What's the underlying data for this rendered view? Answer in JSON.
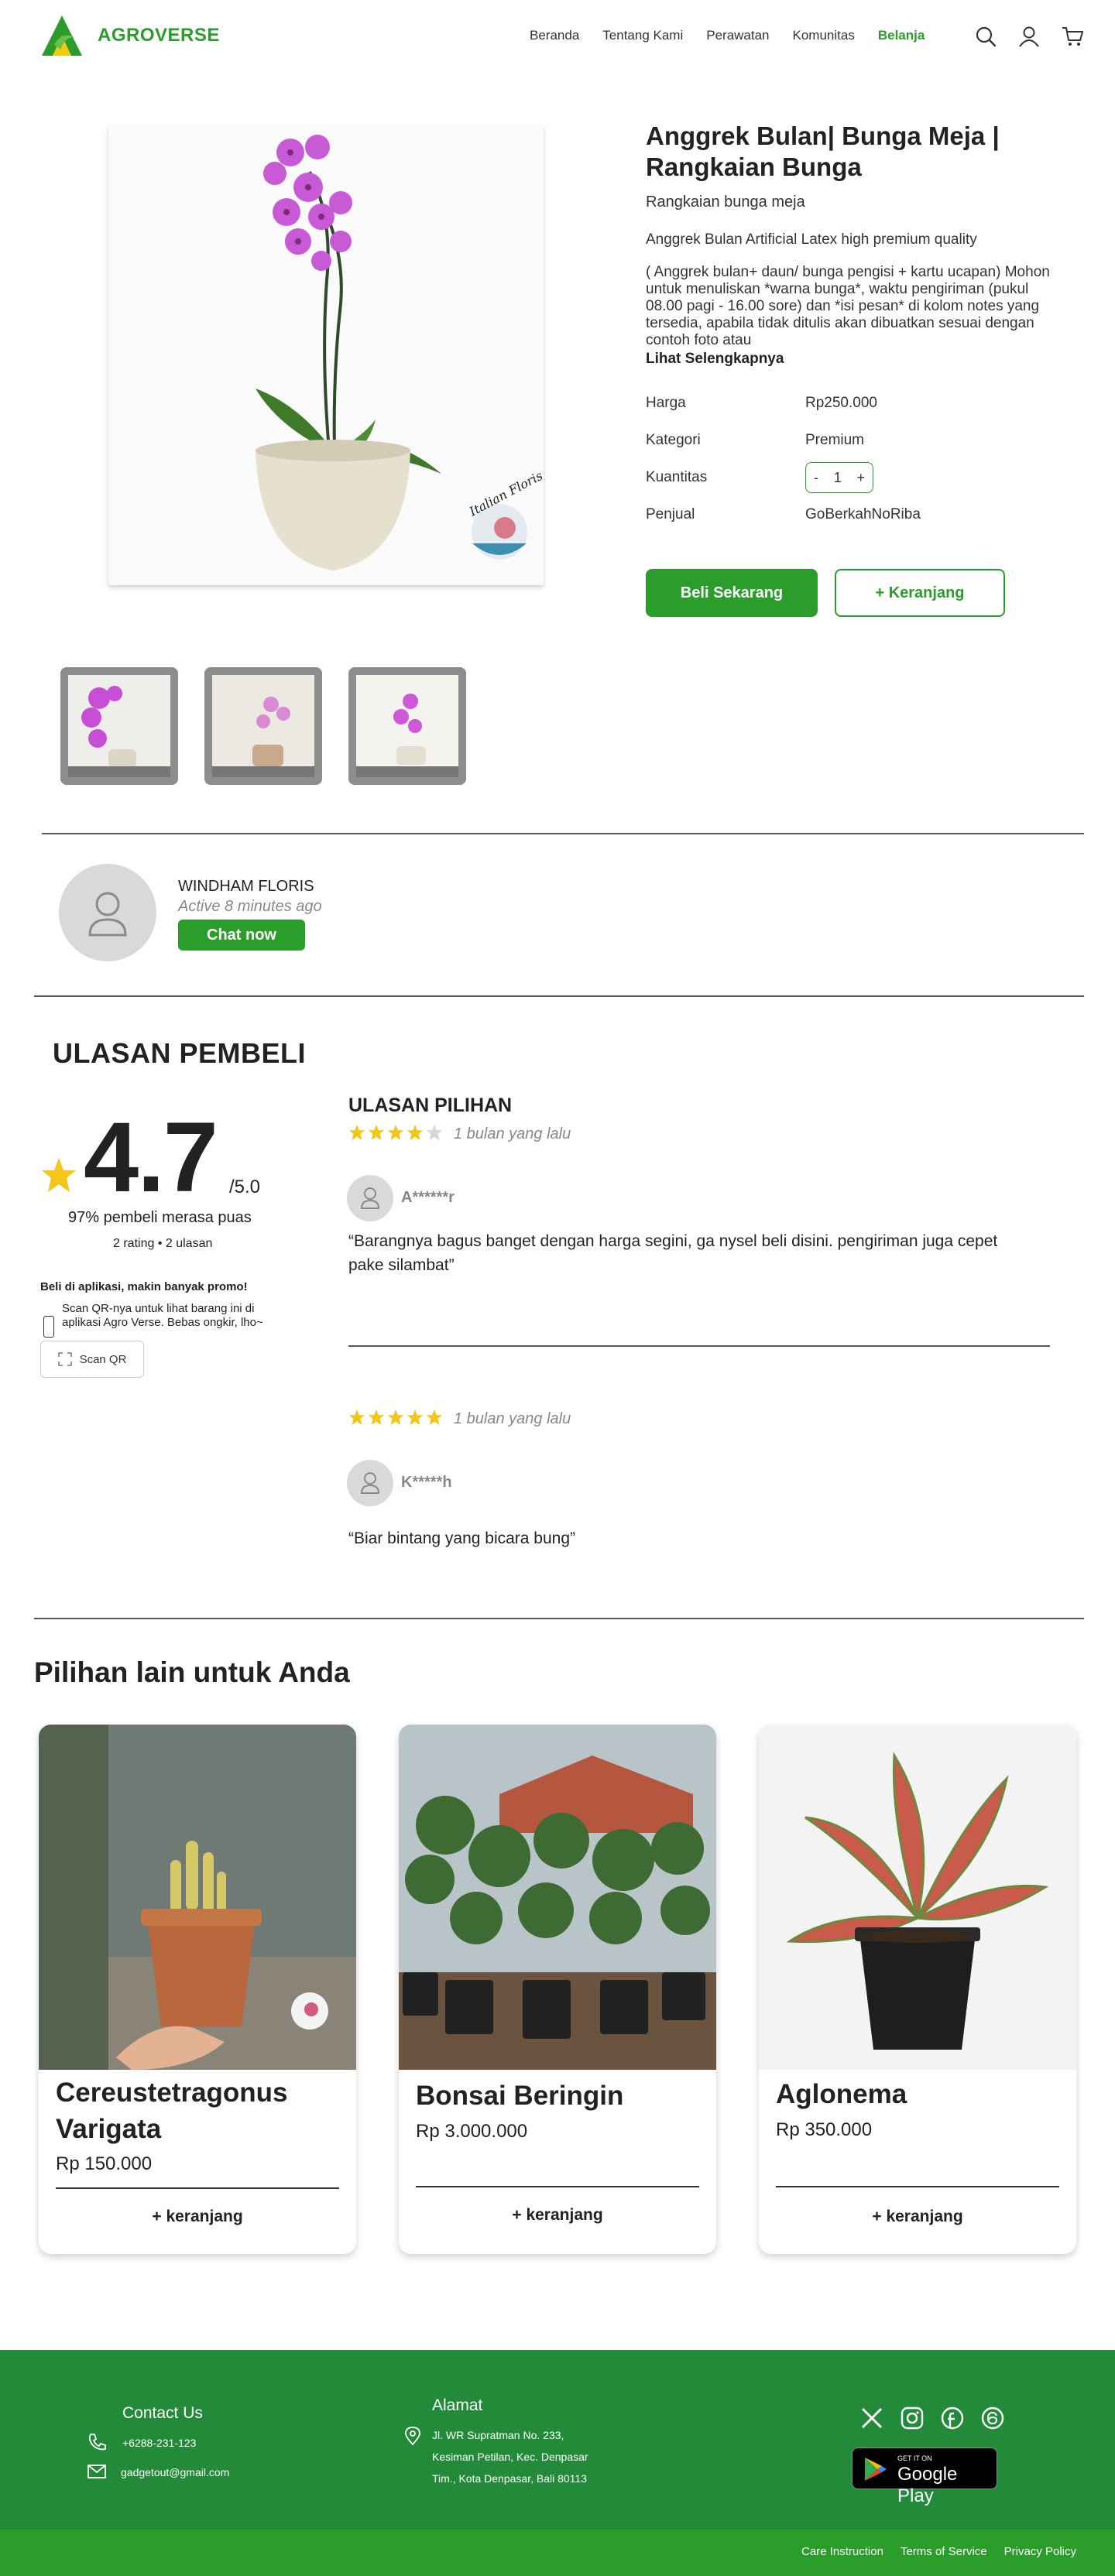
{
  "brand": {
    "name": "AGROVERSE",
    "accent": "#2a9d2a"
  },
  "nav": {
    "items": [
      "Beranda",
      "Tentang Kami",
      "Perawatan",
      "Komunitas",
      "Belanja"
    ],
    "active": "Belanja"
  },
  "header_icons": [
    "search-icon",
    "user-icon",
    "cart-icon"
  ],
  "product": {
    "title": "Anggrek Bulan| Bunga Meja | Rangkaian Bunga",
    "subtitle": "Rangkaian bunga meja",
    "desc1": "Anggrek Bulan Artificial Latex high premium quality",
    "desc2": "( Anggrek bulan+ daun/ bunga pengisi + kartu ucapan) Mohon untuk menuliskan *warna bunga*, waktu pengiriman (pukul 08.00 pagi -  16.00 sore) dan *isi pesan* di kolom notes yang tersedia, apabila tidak ditulis akan dibuatkan sesuai dengan contoh foto atau",
    "more": "Lihat Selengkapnya",
    "image_watermark": "Italian Floris",
    "specs": {
      "price_label": "Harga",
      "price": "Rp250.000",
      "category_label": "Kategori",
      "category": "Premium",
      "qty_label": "Kuantitas",
      "qty_minus": "-",
      "qty_value": "1",
      "qty_plus": "+",
      "seller_label": "Penjual",
      "seller": "GoBerkahNoRiba"
    },
    "buy_label": "Beli Sekarang",
    "cart_label": "+ Keranjang"
  },
  "seller": {
    "name": "WINDHAM FLORIS",
    "status": "Active 8 minutes ago",
    "chat_label": "Chat now"
  },
  "reviews": {
    "heading": "ULASAN PEMBELI",
    "score": "4.7",
    "score_max": "/5.0",
    "satisfied": "97% pembeli merasa puas",
    "rating_count": "2 rating",
    "review_count": "2 ulasan",
    "promo_title": "Beli di aplikasi, makin banyak promo!",
    "promo_text": "Scan QR-nya untuk lihat barang ini di aplikasi Agro Verse. Bebas ongkir, lho~",
    "scan_label": "Scan QR",
    "featured_heading": "ULASAN PILIHAN",
    "items": [
      {
        "stars": 4,
        "time": "1 bulan yang lalu",
        "name": "A******r",
        "text": "“Barangnya bagus banget dengan harga segini, ga nysel beli disini. pengiriman juga cepet pake silambat”"
      },
      {
        "stars": 5,
        "time": "1 bulan yang lalu",
        "name": "K*****h",
        "text": "“Biar bintang yang bicara bung”"
      }
    ],
    "star_color": "#f5c518"
  },
  "recommendations": {
    "heading": "Pilihan lain untuk Anda",
    "items": [
      {
        "name": "Cereustetragonus Varigata",
        "price": "Rp 150.000",
        "add": "+ keranjang"
      },
      {
        "name": "Bonsai Beringin",
        "price": "Rp 3.000.000",
        "add": "+ keranjang"
      },
      {
        "name": "Aglonema",
        "price": "Rp 350.000",
        "add": "+ keranjang"
      }
    ]
  },
  "footer": {
    "contact_title": "Contact Us",
    "phone": "+6288-231-123",
    "email": "gadgetout@gmail.com",
    "address_title": "Alamat",
    "address_lines": [
      "Jl. WR Supratman No. 233,",
      "Kesiman Petilan, Kec. Denpasar",
      "Tim., Kota Denpasar, Bali 80113"
    ],
    "social": [
      "x-icon",
      "instagram-icon",
      "facebook-icon",
      "threads-icon"
    ],
    "gplay_small": "GET IT ON",
    "gplay_big": "Google Play",
    "links": [
      "Care Instruction",
      "Terms of Service",
      "Privacy Policy"
    ],
    "bg": "#238a3a"
  }
}
